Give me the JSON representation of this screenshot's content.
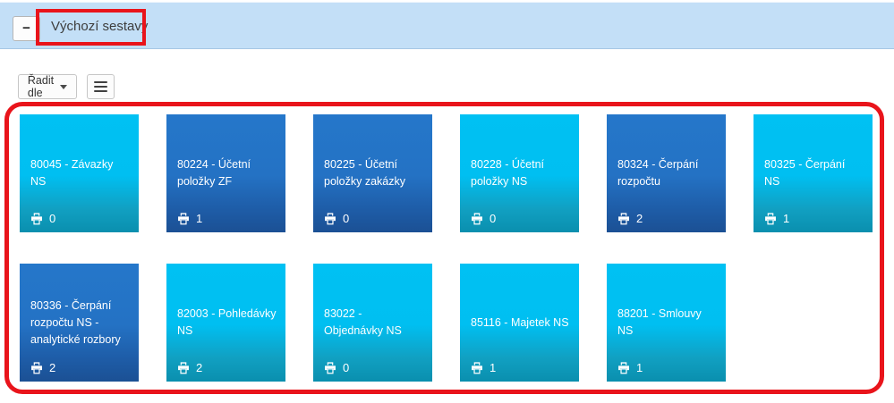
{
  "header": {
    "collapse_button": "−",
    "title": "Výchozí sestavy"
  },
  "toolbar": {
    "sort_button_label": "Řadit dle"
  },
  "icons": {
    "collapse": "minus-icon",
    "sort_caret": "caret-down-icon",
    "menu": "hamburger-menu-icon",
    "tile_count": "printer-icon"
  },
  "colors": {
    "header_bg": "#c3dff7",
    "tile_cyan_top": "#00c1f3",
    "tile_cyan_bottom": "#0a8fae",
    "tile_blue_top": "#2577ca",
    "tile_blue_bottom": "#1b5094",
    "annotation_red": "#e9141b",
    "tile_text": "#ffffff"
  },
  "tiles": [
    {
      "title": "80045 - Závazky NS",
      "count": "0",
      "variant": "cyan"
    },
    {
      "title": "80224 - Účetní položky ZF",
      "count": "1",
      "variant": "blue"
    },
    {
      "title": "80225 - Účetní položky zakázky",
      "count": "0",
      "variant": "blue"
    },
    {
      "title": "80228 - Účetní položky NS",
      "count": "0",
      "variant": "cyan"
    },
    {
      "title": "80324 - Čerpání rozpočtu",
      "count": "2",
      "variant": "blue"
    },
    {
      "title": "80325 - Čerpání NS",
      "count": "1",
      "variant": "cyan"
    },
    {
      "title": "80336 - Čerpání rozpočtu NS - analytické rozbory",
      "count": "2",
      "variant": "blue"
    },
    {
      "title": "82003 - Pohledávky NS",
      "count": "2",
      "variant": "cyan"
    },
    {
      "title": "83022 - Objednávky NS",
      "count": "0",
      "variant": "cyan"
    },
    {
      "title": "85116 - Majetek NS",
      "count": "1",
      "variant": "cyan"
    },
    {
      "title": "88201 - Smlouvy NS",
      "count": "1",
      "variant": "cyan"
    }
  ]
}
